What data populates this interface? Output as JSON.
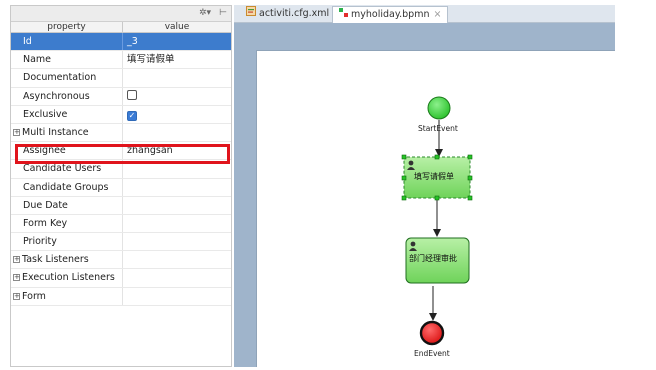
{
  "properties": {
    "column_property": "property",
    "column_value": "value",
    "rows": [
      {
        "label": "Id",
        "value": "_3"
      },
      {
        "label": "Name",
        "value": "填写请假单"
      },
      {
        "label": "Documentation",
        "value": ""
      },
      {
        "label": "Asynchronous",
        "checked": false
      },
      {
        "label": "Exclusive",
        "checked": true
      },
      {
        "label": "Multi Instance",
        "value": ""
      },
      {
        "label": "Assignee",
        "value": "zhangsan"
      },
      {
        "label": "Candidate Users",
        "value": ""
      },
      {
        "label": "Candidate Groups",
        "value": ""
      },
      {
        "label": "Due Date",
        "value": ""
      },
      {
        "label": "Form Key",
        "value": ""
      },
      {
        "label": "Priority",
        "value": ""
      },
      {
        "label": "Task Listeners",
        "value": ""
      },
      {
        "label": "Execution Listeners",
        "value": ""
      },
      {
        "label": "Form",
        "value": ""
      }
    ]
  },
  "tabs": [
    {
      "label": "activiti.cfg.xml",
      "icon": "xml-file-icon"
    },
    {
      "label": "myholiday.bpmn",
      "icon": "bpmn-file-icon"
    }
  ],
  "diagram": {
    "start_label": "StartEvent",
    "task1_label": "填写请假单",
    "task2_label": "部门经理审批",
    "end_label": "EndEvent"
  },
  "colors": {
    "selected_row": "#3d7ccd",
    "highlight_box": "#e0141c",
    "task_fill": "#8fe07a",
    "start_event": "#4ed64e",
    "end_event": "#e31b1b"
  }
}
